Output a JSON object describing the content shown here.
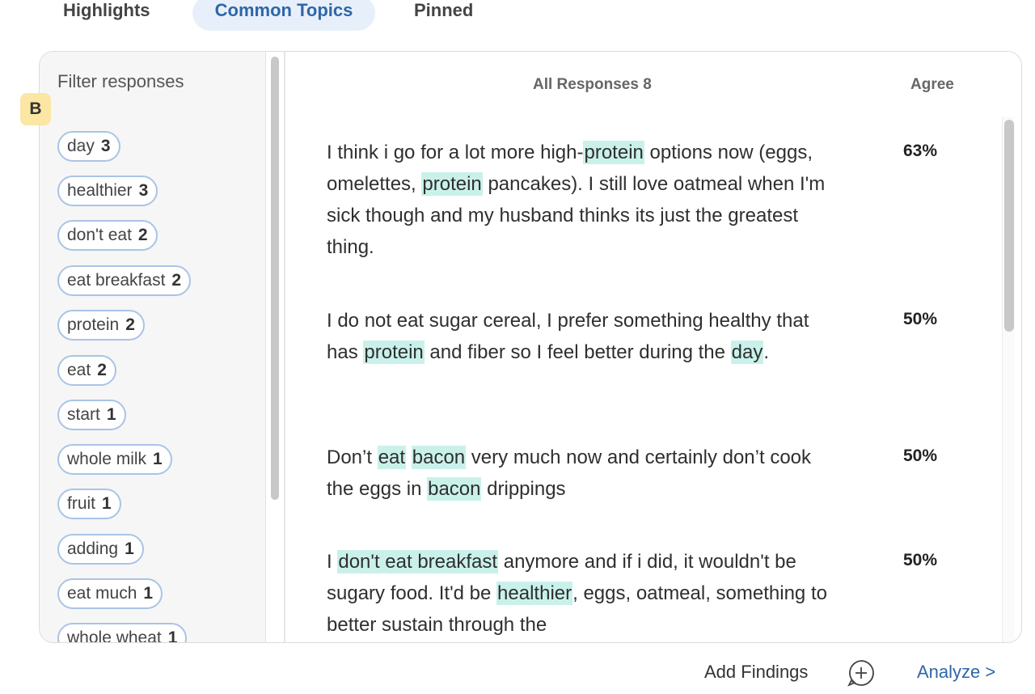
{
  "tabs": [
    {
      "label": "Highlights",
      "active": false
    },
    {
      "label": "Common Topics",
      "active": true
    },
    {
      "label": "Pinned",
      "active": false
    }
  ],
  "sidebar": {
    "title": "Filter responses",
    "badge": "B",
    "chips": [
      {
        "label": "day",
        "count": "3"
      },
      {
        "label": "healthier",
        "count": "3"
      },
      {
        "label": "don't eat",
        "count": "2"
      },
      {
        "label": "eat breakfast",
        "count": "2"
      },
      {
        "label": "protein",
        "count": "2"
      },
      {
        "label": "eat",
        "count": "2"
      },
      {
        "label": "start",
        "count": "1"
      },
      {
        "label": "whole milk",
        "count": "1"
      },
      {
        "label": "fruit",
        "count": "1"
      },
      {
        "label": "adding",
        "count": "1"
      },
      {
        "label": "eat much",
        "count": "1"
      },
      {
        "label": "whole wheat",
        "count": "1"
      }
    ]
  },
  "responses_header": {
    "all_label": "All Responses 8",
    "agree_label": "Agree"
  },
  "responses": [
    {
      "agree": "63%"
    },
    {
      "agree": "50%"
    },
    {
      "agree": "50%"
    },
    {
      "agree": "50%"
    }
  ],
  "footer": {
    "add_findings": "Add Findings",
    "analyze": "Analyze >"
  },
  "colors": {
    "accent": "#2f66a8",
    "highlight": "#c9f1ea",
    "chip_border": "#a9c4e6",
    "badge": "#fbe7a3"
  }
}
